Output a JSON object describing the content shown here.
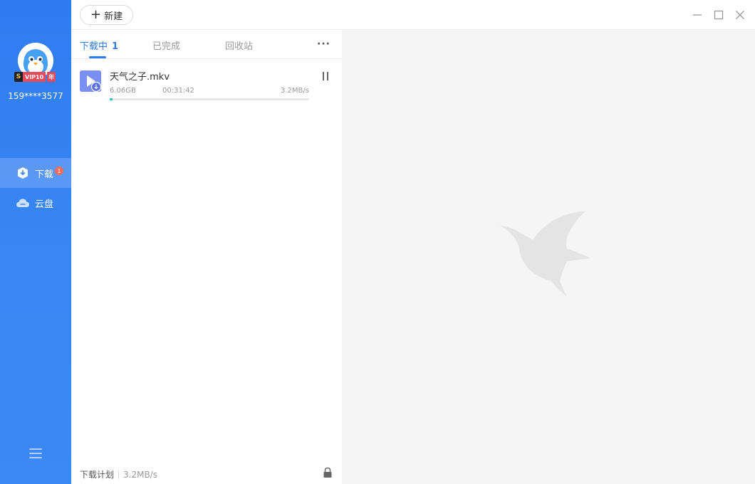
{
  "user": {
    "vip_badge_s": "S",
    "vip_badge_label": "VIP10",
    "vip_badge_year": "年",
    "username": "159****3577"
  },
  "sidebar": {
    "items": [
      {
        "label": "下载",
        "badge": "1",
        "icon": "download-shield-icon",
        "active": true
      },
      {
        "label": "云盘",
        "icon": "cloud-icon",
        "active": false
      }
    ],
    "menu_icon": "hamburger-menu-icon"
  },
  "toolbar": {
    "new_button_label": "新建",
    "window_controls": [
      "minimize-icon",
      "maximize-icon",
      "close-icon"
    ]
  },
  "tabs": [
    {
      "label": "下载中",
      "count": "1",
      "active": true
    },
    {
      "label": "已完成",
      "active": false
    },
    {
      "label": "回收站",
      "active": false
    }
  ],
  "more_label": "···",
  "tasks": [
    {
      "name": "天气之子.mkv",
      "size": "6.06GB",
      "remaining_time": "00:31:42",
      "speed": "3.2MB/s",
      "progress": 0.015,
      "state": "downloading"
    }
  ],
  "footer": {
    "plan_label": "下载计划",
    "speed": "3.2MB/s"
  },
  "colors": {
    "accent": "#2f7bf0",
    "sidebar": "#3a86f4",
    "progress": "#22c1c3",
    "badge": "#f36b5a"
  }
}
